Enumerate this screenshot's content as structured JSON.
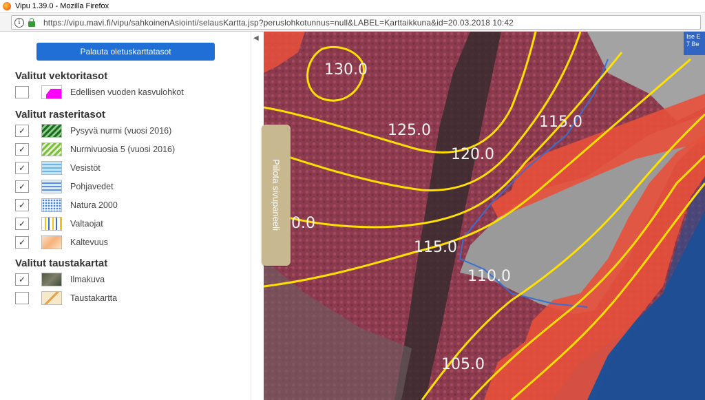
{
  "browser": {
    "window_title": "Vipu 1.39.0 - Mozilla Firefox",
    "url": "https://vipu.mavi.fi/vipu/sahkoinenAsiointi/selausKartta.jsp?peruslohkotunnus=null&LABEL=Karttaikkuna&id=20.03.2018 10:42"
  },
  "panel": {
    "reset_button": "Palauta oletuskarttatasot",
    "vector_section": "Valitut vektoritasot",
    "raster_section": "Valitut rasteritasot",
    "background_section": "Valitut taustakartat",
    "vector_layers": [
      {
        "label": "Edellisen vuoden kasvulohkot",
        "checked": "",
        "icon": "magenta-parcel-icon"
      }
    ],
    "raster_layers": [
      {
        "label": "Pysyvä nurmi (vuosi 2016)",
        "checked": "✓",
        "icon": "dark-green-hatch-icon"
      },
      {
        "label": "Nurmivuosia 5 (vuosi 2016)",
        "checked": "✓",
        "icon": "light-green-hatch-icon"
      },
      {
        "label": "Vesistöt",
        "checked": "✓",
        "icon": "water-waves-icon"
      },
      {
        "label": "Pohjavedet",
        "checked": "✓",
        "icon": "groundwater-waves-icon"
      },
      {
        "label": "Natura 2000",
        "checked": "✓",
        "icon": "natura-icon"
      },
      {
        "label": "Valtaojat",
        "checked": "✓",
        "icon": "ditch-stripes-icon"
      },
      {
        "label": "Kaltevuus",
        "checked": "✓",
        "icon": "slope-icon"
      }
    ],
    "background_layers": [
      {
        "label": "Ilmakuva",
        "checked": "✓",
        "icon": "aerial-photo-icon"
      },
      {
        "label": "Taustakartta",
        "checked": "",
        "icon": "background-map-icon"
      }
    ]
  },
  "side_tab": {
    "label": "Piilota sivupaneeli"
  },
  "map": {
    "contour_labels": [
      "130.0",
      "125.0",
      "120.0",
      "115.0",
      "0.0",
      "115.0",
      "110.0",
      "105.0"
    ],
    "badge_lines": [
      "Ise E",
      "7 Be"
    ],
    "colors": {
      "forest": "#8c3b4f",
      "field": "#9a9a9a",
      "slope": "#e8503a",
      "contour": "#ffe000",
      "water": "#1f4f94",
      "border": "#3a6fd0"
    }
  }
}
